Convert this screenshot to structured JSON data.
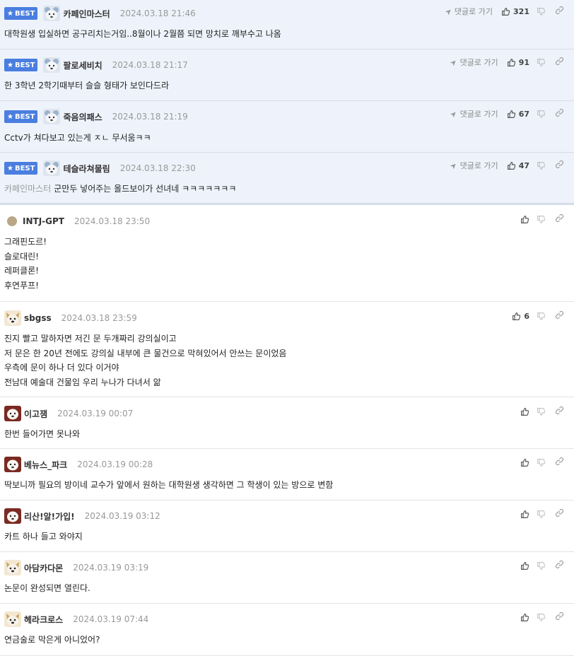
{
  "labels": {
    "best": "BEST",
    "goto": "댓글로 가기"
  },
  "colors": {
    "best_badge": "#4a7ee0",
    "best_row_bg": "#eef3fb",
    "mention": "#999999"
  },
  "comments": [
    {
      "best": true,
      "avatar": "bear-avatar",
      "nickname": "카페인마스터",
      "date": "2024.03.18 21:46",
      "likes": "321",
      "mention": "",
      "lines": [
        "대학원생 입실하면 공구리치는거임..8월이나 2월쯤 되면 망치로 깨부수고 나옴"
      ]
    },
    {
      "best": true,
      "avatar": "bear-avatar",
      "nickname": "팔로세비치",
      "date": "2024.03.18 21:17",
      "likes": "91",
      "mention": "",
      "lines": [
        "한 3학년 2학기때부터 슬슬 형태가 보인다드라"
      ]
    },
    {
      "best": true,
      "avatar": "bear-avatar",
      "nickname": "죽음의패스",
      "date": "2024.03.18 21:19",
      "likes": "67",
      "mention": "",
      "lines": [
        "Cctv가 쳐다보고 있는게 ㅈㄴ 무서움ㅋㅋ"
      ]
    },
    {
      "best": true,
      "avatar": "bear-avatar",
      "nickname": "테슬라쳐물림",
      "date": "2024.03.18 22:30",
      "likes": "47",
      "mention": "카페인마스터",
      "lines": [
        "군만두 넣어주는 올드보이가 선녀네 ㅋㅋㅋㅋㅋㅋㅋ"
      ]
    },
    {
      "best": false,
      "avatar": "dot-avatar",
      "nickname": "INTJ-GPT",
      "date": "2024.03.18 23:50",
      "likes": "",
      "mention": "",
      "lines": [
        "그래핀도르!",
        "슬로대린!",
        "레퍼클론!",
        "후연푸프!"
      ]
    },
    {
      "best": false,
      "avatar": "dog-avatar",
      "nickname": "sbgss",
      "date": "2024.03.18 23:59",
      "likes": "6",
      "mention": "",
      "lines": [
        "진지 빨고 말하자면 저긴 문 두개짜리 강의실이고",
        "저 문은 한 20년 전에도 강의실 내부에 큰 물건으로 막혀있어서 안쓰는 문이었음",
        "우측에 문이 하나 더 있다 이거야",
        "전남대 예술대 건물임 우리 누나가 다녀서 앎"
      ]
    },
    {
      "best": false,
      "avatar": "red-avatar",
      "nickname": "이고잼",
      "date": "2024.03.19 00:07",
      "likes": "",
      "mention": "",
      "lines": [
        "한번 들어가면 못나와"
      ]
    },
    {
      "best": false,
      "avatar": "red-avatar",
      "nickname": "베뉴스_파크",
      "date": "2024.03.19 00:28",
      "likes": "",
      "mention": "",
      "lines": [
        "딱보니까 필요의 방이네 교수가 앞에서 원하는 대학원생 생각하면 그 학생이 있는 방으로 변함"
      ]
    },
    {
      "best": false,
      "avatar": "red-avatar",
      "nickname": "리산!알!가입!",
      "date": "2024.03.19 03:12",
      "likes": "",
      "mention": "",
      "lines": [
        "카트 하나 들고 와야지"
      ]
    },
    {
      "best": false,
      "avatar": "dog-avatar",
      "nickname": "아담카다몬",
      "date": "2024.03.19 03:19",
      "likes": "",
      "mention": "",
      "lines": [
        "논문이 완성되면 열린다."
      ]
    },
    {
      "best": false,
      "avatar": "dog-avatar",
      "nickname": "헤라크로스",
      "date": "2024.03.19 07:44",
      "likes": "",
      "mention": "",
      "lines": [
        "연금술로 막은게 아니었어?"
      ]
    }
  ]
}
